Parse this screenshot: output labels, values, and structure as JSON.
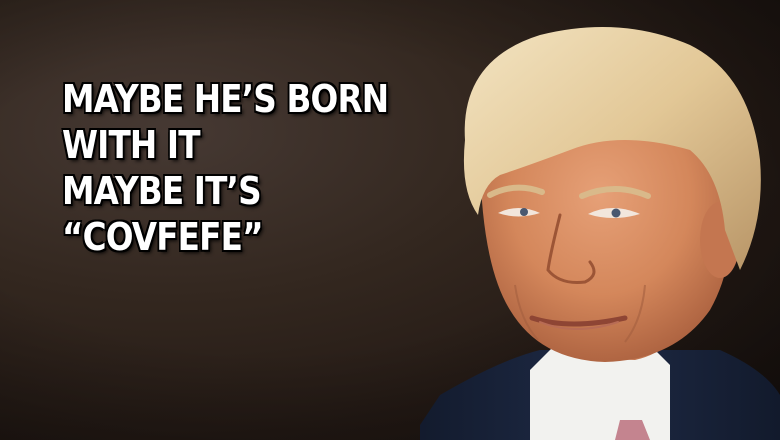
{
  "meme": {
    "caption_lines": [
      "MAYBE HE’S BORN",
      "WITH IT",
      "MAYBE IT’S",
      "“COVFEFE”"
    ]
  },
  "colors": {
    "background": "#2a1f1a",
    "text": "#ffffff",
    "text_outline": "#000000",
    "hair": "#e8d3a8",
    "skin": "#d98a5f",
    "suit": "#1c2740",
    "shirt": "#f4f4f2",
    "tie": "#c4848f"
  }
}
